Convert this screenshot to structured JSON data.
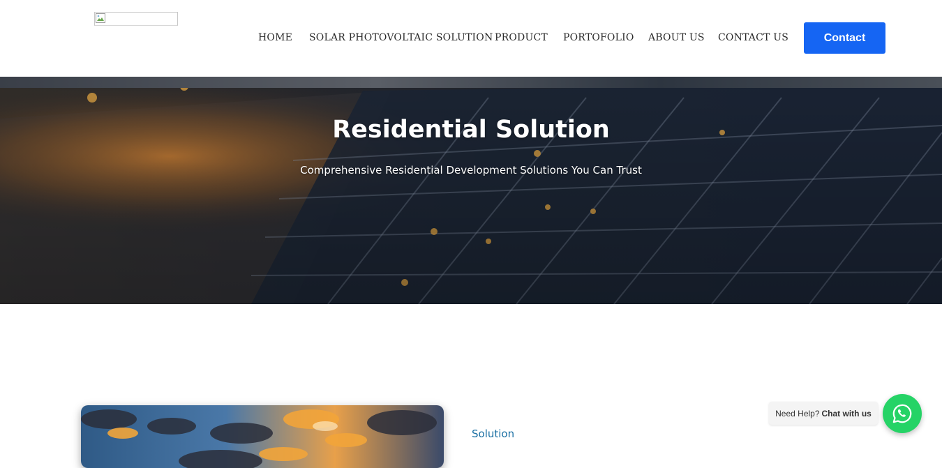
{
  "header": {
    "nav": [
      {
        "label": "HOME"
      },
      {
        "label": "SOLAR PHOTOVOLTAIC SOLUTION"
      },
      {
        "label": "PRODUCT"
      },
      {
        "label": "PORTOFOLIO"
      },
      {
        "label": "ABOUT US"
      },
      {
        "label": "CONTACT US"
      }
    ],
    "contact_label": "Contact"
  },
  "hero": {
    "title": "Residential Solution",
    "subtitle": "Comprehensive Residential Development Solutions You Can Trust"
  },
  "section": {
    "label": "Solution"
  },
  "chat": {
    "prefix": "Need Help?",
    "cta": "Chat with us",
    "icon": "whatsapp-icon"
  },
  "colors": {
    "accent": "#1565f3",
    "whatsapp": "#25d366",
    "section_label": "#1a6fa3"
  }
}
